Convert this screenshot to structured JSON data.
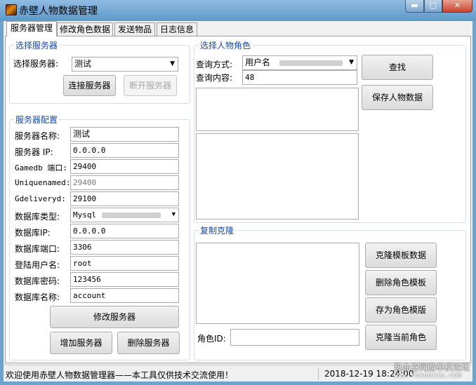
{
  "window": {
    "title": "赤壁人物数据管理",
    "min_glyph": "▬",
    "max_glyph": "□",
    "close_glyph": "✕"
  },
  "tabs": [
    {
      "label": "服务器管理"
    },
    {
      "label": "修改角色数据"
    },
    {
      "label": "发送物品"
    },
    {
      "label": "日志信息"
    }
  ],
  "select_server": {
    "legend": "选择服务器",
    "label": "选择服务器:",
    "value": "测试",
    "connect_label": "连接服务器",
    "disconnect_label": "断开服务器"
  },
  "server_config": {
    "legend": "服务器配置",
    "name_label": "服务器名称:",
    "name_value": "测试",
    "ip_label": "服务器 IP:",
    "ip_value": "0.0.0.0",
    "gamedb_label": "Gamedb 端口:",
    "gamedb_value": "29400",
    "uniquenamed_label": "Uniquenamed:",
    "uniquenamed_value": "29400",
    "gdeliveryd_label": "Gdeliveryd:",
    "gdeliveryd_value": "29100",
    "dbtype_label": "数据库类型:",
    "dbtype_value": "Mysql",
    "dbip_label": "数据库IP:",
    "dbip_value": "0.0.0.0",
    "dbport_label": "数据库端口:",
    "dbport_value": "3306",
    "user_label": "登陆用户名:",
    "user_value": "root",
    "pass_label": "数据库密码:",
    "pass_value": "123456",
    "dbname_label": "数据库名称:",
    "dbname_value": "account",
    "modify_label": "修改服务器",
    "add_label": "增加服务器",
    "delete_label": "删除服务器"
  },
  "select_character": {
    "legend": "选择人物角色",
    "mode_label": "查询方式:",
    "mode_value": "用户名",
    "content_label": "查询内容:",
    "content_value": "48",
    "query_label": "查找",
    "save_label": "保存人物数据"
  },
  "clone": {
    "legend": "复制克隆",
    "template_data_label": "克隆模板数据",
    "delete_template_label": "删除角色模板",
    "save_template_label": "存为角色模版",
    "clone_current_label": "克隆当前角色",
    "role_id_label": "角色ID:",
    "role_id_value": ""
  },
  "status": {
    "message": "欢迎使用赤壁人物数据管理器——本工具仅供技术交流使用！",
    "datetime": "2018-12-19 18:24:00",
    "watermark": "热血谷网游单机论坛",
    "watermark_url": "www.rexuexia.com"
  },
  "colors": {
    "legend": "#1a48a8",
    "titlebar": "#6fa3cf",
    "close_button": "#c7442f"
  }
}
